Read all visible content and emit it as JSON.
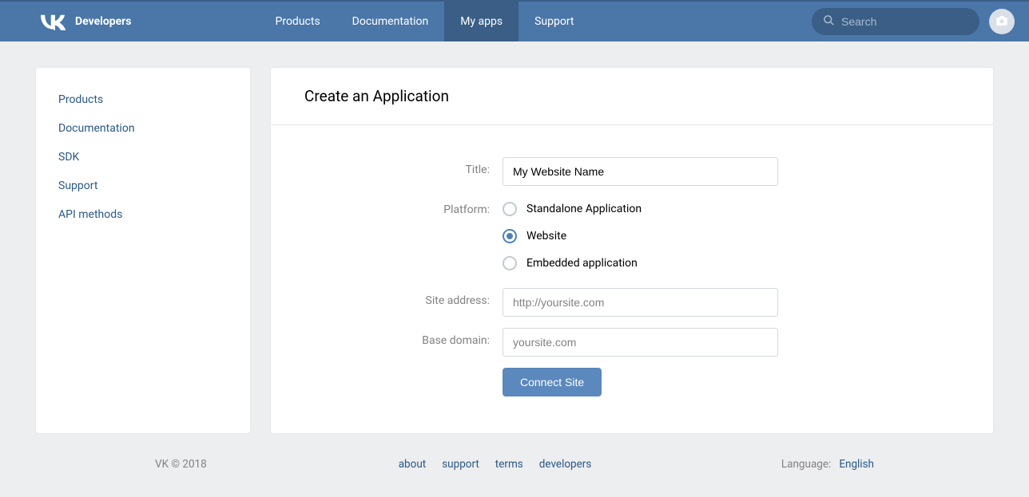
{
  "header": {
    "brand": "Developers",
    "nav": [
      {
        "label": "Products",
        "active": false
      },
      {
        "label": "Documentation",
        "active": false
      },
      {
        "label": "My apps",
        "active": true
      },
      {
        "label": "Support",
        "active": false
      }
    ],
    "search_placeholder": "Search"
  },
  "sidebar": {
    "items": [
      {
        "label": "Products"
      },
      {
        "label": "Documentation"
      },
      {
        "label": "SDK"
      },
      {
        "label": "Support"
      },
      {
        "label": "API methods"
      }
    ]
  },
  "main": {
    "title": "Create an Application",
    "fields": {
      "title": {
        "label": "Title:",
        "value": "My Website Name"
      },
      "platform": {
        "label": "Platform:",
        "options": [
          {
            "label": "Standalone Application",
            "selected": false
          },
          {
            "label": "Website",
            "selected": true
          },
          {
            "label": "Embedded application",
            "selected": false
          }
        ]
      },
      "site_address": {
        "label": "Site address:",
        "placeholder": "http://yoursite.com"
      },
      "base_domain": {
        "label": "Base domain:",
        "placeholder": "yoursite.com"
      }
    },
    "submit_label": "Connect Site"
  },
  "footer": {
    "copyright": "VK © 2018",
    "links": [
      {
        "label": "about"
      },
      {
        "label": "support"
      },
      {
        "label": "terms"
      },
      {
        "label": "developers"
      }
    ],
    "language_label": "Language:",
    "language_value": "English"
  }
}
